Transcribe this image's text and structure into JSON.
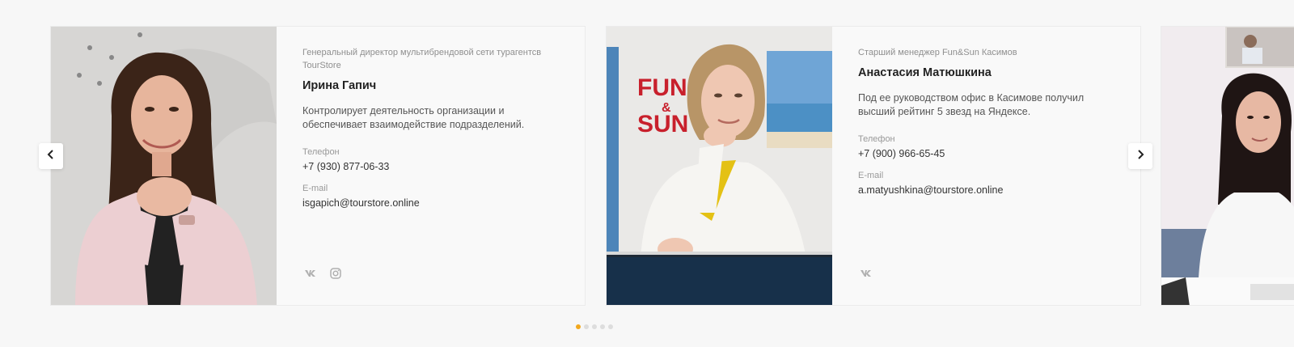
{
  "cards": [
    {
      "position": "Генеральный директор мультибрендовой сети турагентсв TourStore",
      "name": "Ирина Гапич",
      "description": "Контролирует деятельность организации и обеспечивает взаимодействие подразделений.",
      "phone_label": "Телефон",
      "phone": "+7 (930) 877-06-33",
      "email_label": "E-mail",
      "email": "isgapich@tourstore.online",
      "socials": [
        "vk-icon",
        "instagram-icon"
      ]
    },
    {
      "position": "Старший менеджер Fun&Sun Касимов",
      "name": "Анастасия Матюшкина",
      "description": "Под ее руководством офис в Касимове получил высший рейтинг 5 звезд на Яндексе.",
      "phone_label": "Телефон",
      "phone": "+7 (900) 966-65-45",
      "email_label": "E-mail",
      "email": "a.matyushkina@tourstore.online",
      "socials": [
        "vk-icon"
      ],
      "sign_text": [
        "FUN",
        "&",
        "SUN"
      ]
    }
  ],
  "pagination": {
    "count": 5,
    "active_index": 0,
    "active_color": "#f2a81d"
  },
  "colors": {
    "accent": "#f2a81d",
    "sign_red": "#c8202c"
  },
  "icons": {
    "prev": "chevron-left-icon",
    "next": "chevron-right-icon"
  }
}
